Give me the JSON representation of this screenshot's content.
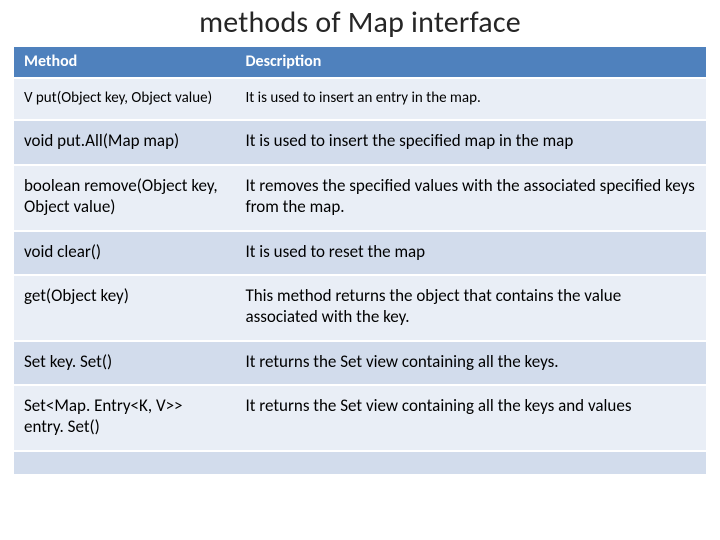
{
  "title": "methods of Map interface",
  "headers": {
    "method": "Method",
    "description": "Description"
  },
  "rows": [
    {
      "method": "V put(Object key, Object value)",
      "description": "It is used to insert an entry in the map."
    },
    {
      "method": "void put.All(Map map)",
      "description": "It is used to insert the specified map in the map"
    },
    {
      "method": "boolean remove(Object key, Object value)",
      "description": "It removes the specified values with the associated specified keys from the map."
    },
    {
      "method": "void clear()",
      "description": "It is used to reset the map"
    },
    {
      "method": "get(Object key)",
      "description": "This method returns the object that contains the value associated with the key."
    },
    {
      "method": "Set key. Set()",
      "description": "It returns the Set view containing all the keys."
    },
    {
      "method": "Set<Map. Entry<K, V>> entry. Set()",
      "description": "It returns the Set view containing all the keys and values"
    },
    {
      "method": "",
      "description": ""
    }
  ]
}
